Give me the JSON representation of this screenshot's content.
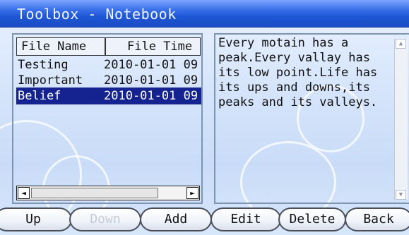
{
  "window": {
    "title": "Toolbox - Notebook"
  },
  "file_list": {
    "columns": [
      "File Name",
      "File Time"
    ],
    "rows": [
      {
        "name": "Testing",
        "time": "2010-01-01 09",
        "selected": false
      },
      {
        "name": "Important",
        "time": "2010-01-01 09",
        "selected": false
      },
      {
        "name": "Belief",
        "time": "2010-01-01 09",
        "selected": true
      }
    ]
  },
  "note": {
    "text": "Every motain has a\npeak.Every vallay has\nits low point.Life has\nits ups and downs,its\npeaks and its valleys."
  },
  "softkeys": [
    {
      "label": "Up",
      "enabled": true
    },
    {
      "label": "Down",
      "enabled": false
    },
    {
      "label": "Add",
      "enabled": true
    },
    {
      "label": "Edit",
      "enabled": true
    },
    {
      "label": "Delete",
      "enabled": true
    },
    {
      "label": "Back",
      "enabled": true
    }
  ],
  "icons": {
    "scroll_left": "◄",
    "scroll_right": "►",
    "scroll_up": "▲",
    "scroll_down": "▼"
  },
  "colors": {
    "titlebar": "#1f57d6",
    "selection": "#14238f"
  }
}
